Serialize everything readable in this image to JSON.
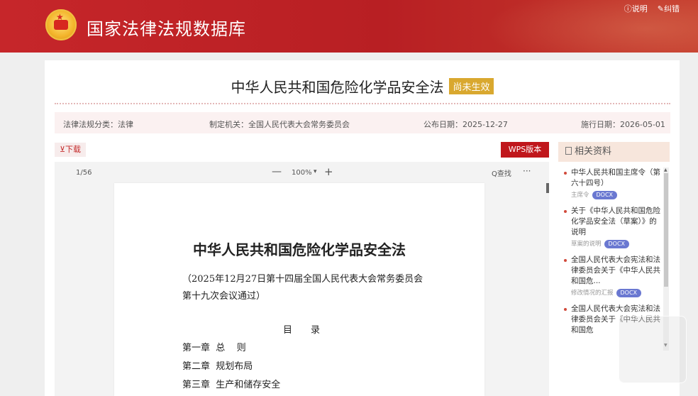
{
  "header": {
    "site_title": "国家法律法规数据库",
    "help_link": "ⓘ说明",
    "feedback_link": "✎纠错"
  },
  "document": {
    "title": "中华人民共和国危险化学品安全法",
    "status": "尚未生效",
    "meta": {
      "category": "法律法规分类：法律",
      "authority": "制定机关：全国人民代表大会常务委员会",
      "publish_date": "公布日期：2025-12-27",
      "effective_date": "施行日期：2026-05-01"
    },
    "download_label": "⊻下载",
    "wps_label": "WPS版本"
  },
  "viewer": {
    "page_count": "1/56",
    "zoom_minus": "—",
    "zoom_level": "100%",
    "zoom_caret": "▾",
    "zoom_plus": "+",
    "find_label": "Q查找",
    "more_label": "···",
    "page": {
      "title": "中华人民共和国危险化学品安全法",
      "subtitle": "（2025年12月27日第十四届全国人民代表大会常务委员会第十九次会议通过）",
      "toc_heading": "目录",
      "toc": [
        "第一章  总    则",
        "第二章  规划布局",
        "第三章  生产和储存安全"
      ]
    }
  },
  "related": {
    "heading": "相关资料",
    "items": [
      {
        "title": "中华人民共和国主席令（第六十四号）",
        "sub": "主席令",
        "badge": "DOCX"
      },
      {
        "title": "关于《中华人民共和国危险化学品安全法（草案）》的说明",
        "sub": "草案的说明",
        "badge": "DOCX"
      },
      {
        "title": "全国人民代表大会宪法和法律委员会关于《中华人民共和国危...",
        "sub": "修改情况的汇报",
        "badge": "DOCX"
      },
      {
        "title": "全国人民代表大会宪法和法律委员会关于《中华人民共和国危",
        "sub": "",
        "badge": ""
      }
    ]
  }
}
